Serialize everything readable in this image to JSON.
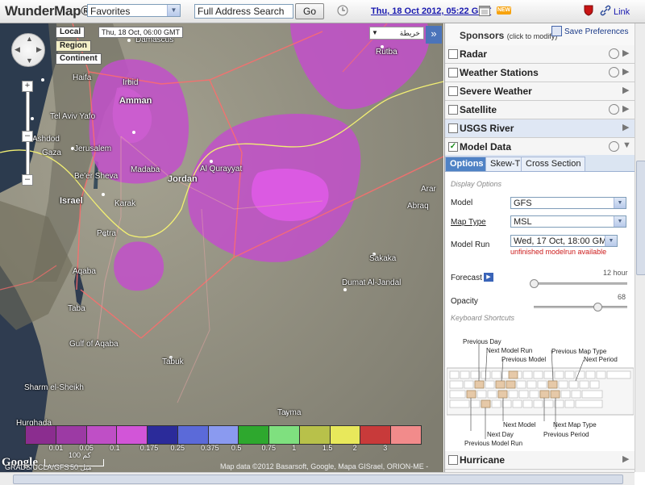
{
  "topbar": {
    "logo": "WunderMap®",
    "favorites_value": "Favorites",
    "search_value": "Full Address Search",
    "go_label": "Go",
    "date_link": "Thu, 18 Oct 2012, 05:22 GMT",
    "new_badge": "NEW",
    "link_label": "Link"
  },
  "map": {
    "time_buttons": [
      "Local",
      "Region",
      "Continent"
    ],
    "map_time": "Thu, 18 Oct, 06:00 GMT",
    "language_select": "خريطة",
    "collapse_label": "»",
    "places": [
      {
        "name": "Damascus",
        "type": "city"
      },
      {
        "name": "Haifa",
        "type": "city"
      },
      {
        "name": "Irbid",
        "type": "city"
      },
      {
        "name": "Amman",
        "type": "city"
      },
      {
        "name": "Tel Aviv Yafo",
        "type": "city"
      },
      {
        "name": "Ashdod",
        "type": "city"
      },
      {
        "name": "Jerusalem",
        "type": "city"
      },
      {
        "name": "Madaba",
        "type": "city"
      },
      {
        "name": "Gaza",
        "type": "city"
      },
      {
        "name": "Be'er Sheva",
        "type": "city"
      },
      {
        "name": "Israel",
        "type": "country"
      },
      {
        "name": "Jordan",
        "type": "country"
      },
      {
        "name": "Al Qurayyat",
        "type": "city"
      },
      {
        "name": "Rutba",
        "type": "city"
      },
      {
        "name": "Petra",
        "type": "city"
      },
      {
        "name": "Karak",
        "type": "city"
      },
      {
        "name": "Aqaba",
        "type": "city"
      },
      {
        "name": "Taba",
        "type": "city"
      },
      {
        "name": "Sakaka",
        "type": "city"
      },
      {
        "name": "Dumat Al-Jandal",
        "type": "city"
      },
      {
        "name": "Tabuk",
        "type": "city"
      },
      {
        "name": "Tayma",
        "type": "city"
      },
      {
        "name": "Hurghada",
        "type": "city"
      },
      {
        "name": "Sharm el-Sheikh",
        "type": "city"
      },
      {
        "name": "Gulf of Aqaba",
        "type": "water"
      },
      {
        "name": "Arar",
        "type": "city"
      },
      {
        "name": "Abraq",
        "type": "city"
      }
    ],
    "legend": [
      {
        "label": "0.01",
        "color": "#8b2d8f"
      },
      {
        "label": "0.05",
        "color": "#9c3aa4"
      },
      {
        "label": "0.1",
        "color": "#bf4fc6"
      },
      {
        "label": "0.175",
        "color": "#d255d8"
      },
      {
        "label": "0.25",
        "color": "#2b2b9a"
      },
      {
        "label": "0.375",
        "color": "#5b6ad9"
      },
      {
        "label": "0.5",
        "color": "#8a9af0"
      },
      {
        "label": "0.75",
        "color": "#2ea82e"
      },
      {
        "label": "1",
        "color": "#7fe07f"
      },
      {
        "label": "1.5",
        "color": "#b8c14a"
      },
      {
        "label": "2",
        "color": "#e8e85b"
      },
      {
        "label": "3",
        "color": "#c83a3a"
      },
      {
        "label": "",
        "color": "#f28b8b"
      }
    ],
    "google_logo": "Google",
    "attribution": "GRADS/UCLA/GFS",
    "scale_km": "100 كم",
    "scale_mi": "50 ميل",
    "credit": "Map data ©2012 Basarsoft, Google, Mapa GISrael, ORION-ME -"
  },
  "panel": {
    "sponsors_label": "Sponsors",
    "sponsors_sub": "(click to modify)",
    "save_pref": "Save Preferences",
    "layers": [
      {
        "label": "Radar",
        "checked": false,
        "clock": true
      },
      {
        "label": "Weather Stations",
        "checked": false,
        "clock": true
      },
      {
        "label": "Severe Weather",
        "checked": false,
        "clock": false
      },
      {
        "label": "Satellite",
        "checked": false,
        "clock": true
      },
      {
        "label": "USGS River",
        "checked": false,
        "clock": false
      },
      {
        "label": "Model Data",
        "checked": true,
        "clock": true
      }
    ],
    "tabs": [
      "Options",
      "Skew-T",
      "Cross Section"
    ],
    "active_tab": "Options",
    "display_options": "Display Options",
    "model_label": "Model",
    "model_value": "GFS",
    "maptype_label": "Map Type",
    "maptype_value": "MSL",
    "modelrun_label": "Model Run",
    "modelrun_value": "Wed, 17 Oct, 18:00 GMT",
    "warning": "unfinished modelrun available",
    "forecast_label": "Forecast",
    "forecast_value": "12 hour",
    "forecast_level": 0.0,
    "opacity_label": "Opacity",
    "opacity_value": "68",
    "opacity_level": 0.68,
    "keyboard_shortcuts": "Keyboard Shortcuts",
    "kbd_labels": {
      "prev_day": "Previous Day",
      "next_model_run": "Next Model Run",
      "prev_model": "Previous Model",
      "prev_map_type": "Previous Map Type",
      "next_period": "Next Period",
      "next_model": "Next Model",
      "next_map_type": "Next Map Type",
      "next_day": "Next Day",
      "prev_model_run": "Previous Model Run",
      "prev_period": "Previous Period"
    },
    "hurricane_label": "Hurricane"
  }
}
